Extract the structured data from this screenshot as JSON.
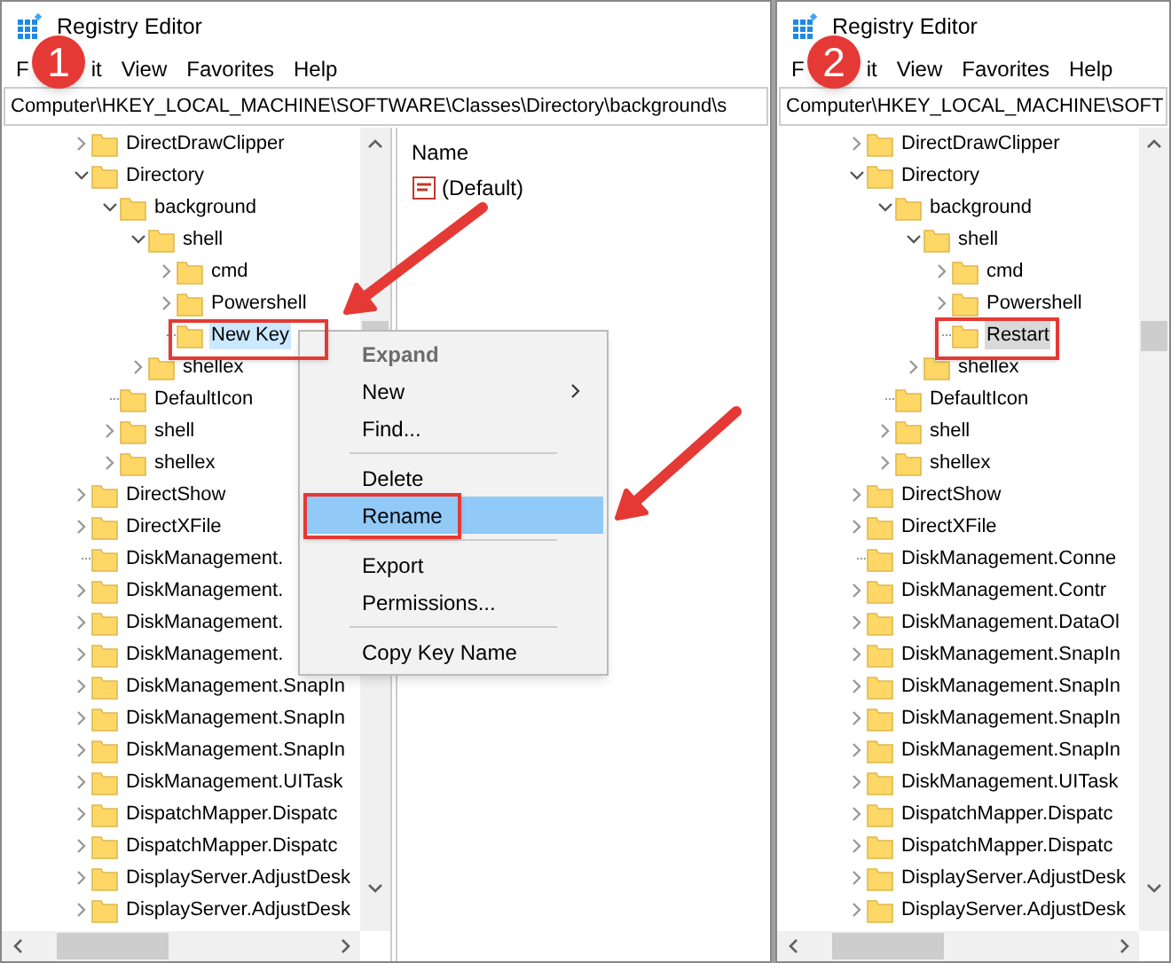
{
  "windows": [
    {
      "title": "Registry Editor",
      "step_badge": "1",
      "menu": [
        "F",
        "it",
        "View",
        "Favorites",
        "Help"
      ],
      "address": "Computer\\HKEY_LOCAL_MACHINE\\SOFTWARE\\Classes\\Directory\\background\\s",
      "tree_focused": true,
      "tree": [
        {
          "label": "DirectDrawClipper",
          "expanded": false,
          "selected": false
        },
        {
          "label": "Directory",
          "expanded": true,
          "selected": false,
          "children": [
            {
              "label": "background",
              "expanded": true,
              "selected": false,
              "children": [
                {
                  "label": "shell",
                  "expanded": true,
                  "selected": false,
                  "children": [
                    {
                      "label": "cmd",
                      "expanded": false,
                      "selected": false
                    },
                    {
                      "label": "Powershell",
                      "expanded": false,
                      "selected": false
                    },
                    {
                      "label": "New Key",
                      "selected": true
                    }
                  ]
                },
                {
                  "label": "shellex",
                  "expanded": false,
                  "selected": false
                }
              ]
            },
            {
              "label": "DefaultIcon",
              "selected": false
            },
            {
              "label": "shell",
              "expanded": false,
              "selected": false
            },
            {
              "label": "shellex",
              "expanded": false,
              "selected": false
            }
          ]
        },
        {
          "label": "DirectShow",
          "expanded": false,
          "selected": false
        },
        {
          "label": "DirectXFile",
          "expanded": false,
          "selected": false
        },
        {
          "label": "DiskManagement.",
          "selected": false
        },
        {
          "label": "DiskManagement.",
          "expanded": false,
          "selected": false
        },
        {
          "label": "DiskManagement.",
          "expanded": false,
          "selected": false
        },
        {
          "label": "DiskManagement.",
          "expanded": false,
          "selected": false
        },
        {
          "label": "DiskManagement.SnapIn",
          "expanded": false,
          "selected": false
        },
        {
          "label": "DiskManagement.SnapIn",
          "expanded": false,
          "selected": false
        },
        {
          "label": "DiskManagement.SnapIn",
          "expanded": false,
          "selected": false
        },
        {
          "label": "DiskManagement.UITask",
          "expanded": false,
          "selected": false
        },
        {
          "label": "DispatchMapper.Dispatc",
          "expanded": false,
          "selected": false
        },
        {
          "label": "DispatchMapper.Dispatc",
          "expanded": false,
          "selected": false
        },
        {
          "label": "DisplayServer.AdjustDesk",
          "expanded": false,
          "selected": false
        },
        {
          "label": "DisplayServer.AdjustDesk",
          "expanded": false,
          "selected": false
        }
      ],
      "values_pane": {
        "column": "Name",
        "values": [
          {
            "name": "(Default)"
          }
        ]
      }
    },
    {
      "title": "Registry Editor",
      "step_badge": "2",
      "menu": [
        "F",
        "it",
        "View",
        "Favorites",
        "Help"
      ],
      "address": "Computer\\HKEY_LOCAL_MACHINE\\SOFT",
      "tree_focused": false,
      "tree": [
        {
          "label": "DirectDrawClipper",
          "expanded": false,
          "selected": false
        },
        {
          "label": "Directory",
          "expanded": true,
          "selected": false,
          "children": [
            {
              "label": "background",
              "expanded": true,
              "selected": false,
              "children": [
                {
                  "label": "shell",
                  "expanded": true,
                  "selected": false,
                  "children": [
                    {
                      "label": "cmd",
                      "expanded": false,
                      "selected": false
                    },
                    {
                      "label": "Powershell",
                      "expanded": false,
                      "selected": false
                    },
                    {
                      "label": "Restart",
                      "selected": true
                    }
                  ]
                },
                {
                  "label": "shellex",
                  "expanded": false,
                  "selected": false
                }
              ]
            },
            {
              "label": "DefaultIcon",
              "selected": false
            },
            {
              "label": "shell",
              "expanded": false,
              "selected": false
            },
            {
              "label": "shellex",
              "expanded": false,
              "selected": false
            }
          ]
        },
        {
          "label": "DirectShow",
          "expanded": false,
          "selected": false
        },
        {
          "label": "DirectXFile",
          "expanded": false,
          "selected": false
        },
        {
          "label": "DiskManagement.Conne",
          "selected": false
        },
        {
          "label": "DiskManagement.Contr",
          "expanded": false,
          "selected": false
        },
        {
          "label": "DiskManagement.DataOl",
          "expanded": false,
          "selected": false
        },
        {
          "label": "DiskManagement.SnapIn",
          "expanded": false,
          "selected": false
        },
        {
          "label": "DiskManagement.SnapIn",
          "expanded": false,
          "selected": false
        },
        {
          "label": "DiskManagement.SnapIn",
          "expanded": false,
          "selected": false
        },
        {
          "label": "DiskManagement.SnapIn",
          "expanded": false,
          "selected": false
        },
        {
          "label": "DiskManagement.UITask",
          "expanded": false,
          "selected": false
        },
        {
          "label": "DispatchMapper.Dispatc",
          "expanded": false,
          "selected": false
        },
        {
          "label": "DispatchMapper.Dispatc",
          "expanded": false,
          "selected": false
        },
        {
          "label": "DisplayServer.AdjustDesk",
          "expanded": false,
          "selected": false
        },
        {
          "label": "DisplayServer.AdjustDesk",
          "expanded": false,
          "selected": false
        }
      ]
    }
  ],
  "context_menu": {
    "items": [
      {
        "kind": "item",
        "label": "Expand",
        "default": true,
        "disabled": true,
        "submenu": false,
        "selected": false
      },
      {
        "kind": "item",
        "label": "New",
        "default": false,
        "disabled": false,
        "submenu": true,
        "selected": false
      },
      {
        "kind": "item",
        "label": "Find...",
        "default": false,
        "disabled": false,
        "submenu": false,
        "selected": false
      },
      {
        "kind": "separator"
      },
      {
        "kind": "item",
        "label": "Delete",
        "default": false,
        "disabled": false,
        "submenu": false,
        "selected": false
      },
      {
        "kind": "item",
        "label": "Rename",
        "default": false,
        "disabled": false,
        "submenu": false,
        "selected": true
      },
      {
        "kind": "separator"
      },
      {
        "kind": "item",
        "label": "Export",
        "default": false,
        "disabled": false,
        "submenu": false,
        "selected": false
      },
      {
        "kind": "item",
        "label": "Permissions...",
        "default": false,
        "disabled": false,
        "submenu": false,
        "selected": false
      },
      {
        "kind": "separator"
      },
      {
        "kind": "item",
        "label": "Copy Key Name",
        "default": false,
        "disabled": false,
        "submenu": false,
        "selected": false
      }
    ]
  }
}
